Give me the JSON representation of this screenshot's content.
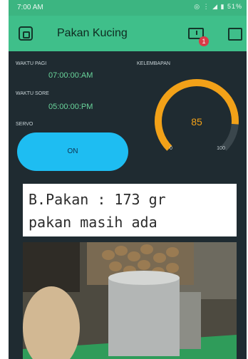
{
  "status_bar": {
    "time": "7:00 AM",
    "icons_text": "◎ ⋮ ◢ ▮ 51%"
  },
  "app_bar": {
    "title": "Pakan Kucing",
    "notification_count": "1"
  },
  "dashboard": {
    "morning_label": "WAKTU PAGI",
    "morning_value": "07:00:00:AM",
    "evening_label": "WAKTU SORE",
    "evening_value": "05:00:00:PM",
    "servo_label": "SERVO",
    "servo_button": "ON",
    "humidity_label": "KELEMBAPAN",
    "gauge": {
      "value": "85",
      "min": "0",
      "max": "100",
      "fraction": 0.85
    }
  },
  "lcd": {
    "line1": "B.Pakan : 173 gr",
    "line2": "pakan masih ada"
  },
  "colors": {
    "accent_green": "#3fbf8a",
    "button_blue": "#1ebdf2",
    "gauge_orange": "#f2a118",
    "background": "#1f2b31"
  }
}
